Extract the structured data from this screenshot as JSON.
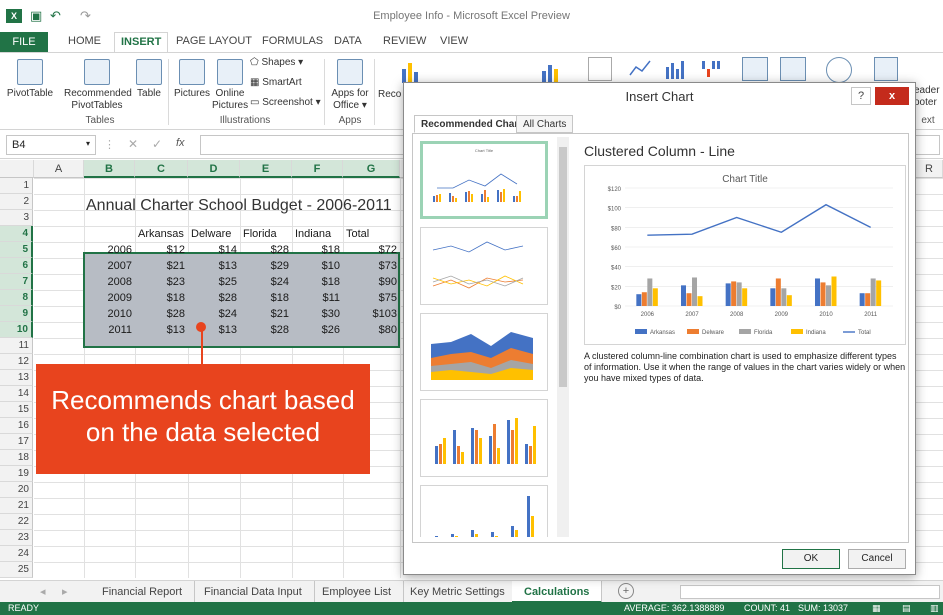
{
  "window": {
    "title": "Employee Info - Microsoft Excel Preview"
  },
  "ribbon_tabs": [
    "FILE",
    "HOME",
    "INSERT",
    "PAGE LAYOUT",
    "FORMULAS",
    "DATA",
    "REVIEW",
    "VIEW"
  ],
  "ribbon": {
    "pivottable": "PivotTable",
    "recommended_pivot_l1": "Recommended",
    "recommended_pivot_l2": "PivotTables",
    "table": "Table",
    "tables_group": "Tables",
    "pictures": "Pictures",
    "online_pictures_l1": "Online",
    "online_pictures_l2": "Pictures",
    "shapes": "Shapes",
    "smartart": "SmartArt",
    "screenshot": "Screenshot",
    "illustrations_group": "Illustrations",
    "apps_l1": "Apps for",
    "apps_l2": "Office",
    "apps_group": "Apps",
    "reco_partial": "Reco",
    "header_partial_l1": "eader",
    "header_partial_l2": "ooter",
    "text_partial": "ext"
  },
  "formula_bar": {
    "name_box": "B4",
    "fx": "fx"
  },
  "columns": [
    "A",
    "B",
    "C",
    "D",
    "E",
    "F",
    "G"
  ],
  "extra_column": "R",
  "rows": [
    "1",
    "2",
    "3",
    "4",
    "5",
    "6",
    "7",
    "8",
    "9",
    "10",
    "11",
    "12",
    "13",
    "14",
    "15",
    "16",
    "17",
    "18",
    "19",
    "20",
    "21",
    "22",
    "23",
    "24",
    "25"
  ],
  "sheet_title": "Annual Charter School Budget - 2006-2011",
  "table": {
    "headers": [
      "Arkansas",
      "Delware",
      "Florida",
      "Indiana",
      "Total"
    ],
    "rows": [
      {
        "year": "2006",
        "vals": [
          "$12",
          "$14",
          "$28",
          "$18",
          "$72"
        ]
      },
      {
        "year": "2007",
        "vals": [
          "$21",
          "$13",
          "$29",
          "$10",
          "$73"
        ]
      },
      {
        "year": "2008",
        "vals": [
          "$23",
          "$25",
          "$24",
          "$18",
          "$90"
        ]
      },
      {
        "year": "2009",
        "vals": [
          "$18",
          "$28",
          "$18",
          "$11",
          "$75"
        ]
      },
      {
        "year": "2010",
        "vals": [
          "$28",
          "$24",
          "$21",
          "$30",
          "$103"
        ]
      },
      {
        "year": "2011",
        "vals": [
          "$13",
          "$13",
          "$28",
          "$26",
          "$80"
        ]
      }
    ]
  },
  "callout": {
    "line1": "Recommends chart based",
    "line2": "on the data selected"
  },
  "dialog": {
    "title": "Insert Chart",
    "help": "?",
    "close": "x",
    "tab_recommended": "Recommended Charts",
    "tab_all": "All Charts",
    "preview_title": "Clustered Column - Line",
    "description": "A clustered column-line combination chart is used to emphasize different types of information. Use it when the range of values in the chart varies widely or when you have mixed types of data.",
    "ok": "OK",
    "cancel": "Cancel",
    "thumb_label": "Chart Title"
  },
  "sheet_tabs": [
    "Financial Report",
    "Financial Data Input",
    "Employee List",
    "Key Metric Settings",
    "Calculations"
  ],
  "status": {
    "ready": "READY",
    "average": "AVERAGE: 362.1388889",
    "count": "COUNT: 41",
    "sum": "SUM: 13037"
  },
  "colors": {
    "excel_green": "#217346",
    "callout": "#e8441e",
    "arkansas": "#4472c4",
    "delware": "#ed7d31",
    "florida": "#a5a5a5",
    "indiana": "#ffc000",
    "total": "#4472c4"
  },
  "chart_data": {
    "type": "bar",
    "title": "Chart Title",
    "categories": [
      "2006",
      "2007",
      "2008",
      "2009",
      "2010",
      "2011"
    ],
    "series": [
      {
        "name": "Arkansas",
        "type": "bar",
        "values": [
          12,
          21,
          23,
          18,
          28,
          13
        ]
      },
      {
        "name": "Delware",
        "type": "bar",
        "values": [
          14,
          13,
          25,
          28,
          24,
          13
        ]
      },
      {
        "name": "Florida",
        "type": "bar",
        "values": [
          28,
          29,
          24,
          18,
          21,
          28
        ]
      },
      {
        "name": "Indiana",
        "type": "bar",
        "values": [
          18,
          10,
          18,
          11,
          30,
          26
        ]
      },
      {
        "name": "Total",
        "type": "line",
        "values": [
          72,
          73,
          90,
          75,
          103,
          80
        ]
      }
    ],
    "ylim": [
      0,
      120
    ],
    "yticks": [
      "$0",
      "$20",
      "$40",
      "$60",
      "$80",
      "$100",
      "$120"
    ],
    "legend": "bottom",
    "grid": true
  }
}
